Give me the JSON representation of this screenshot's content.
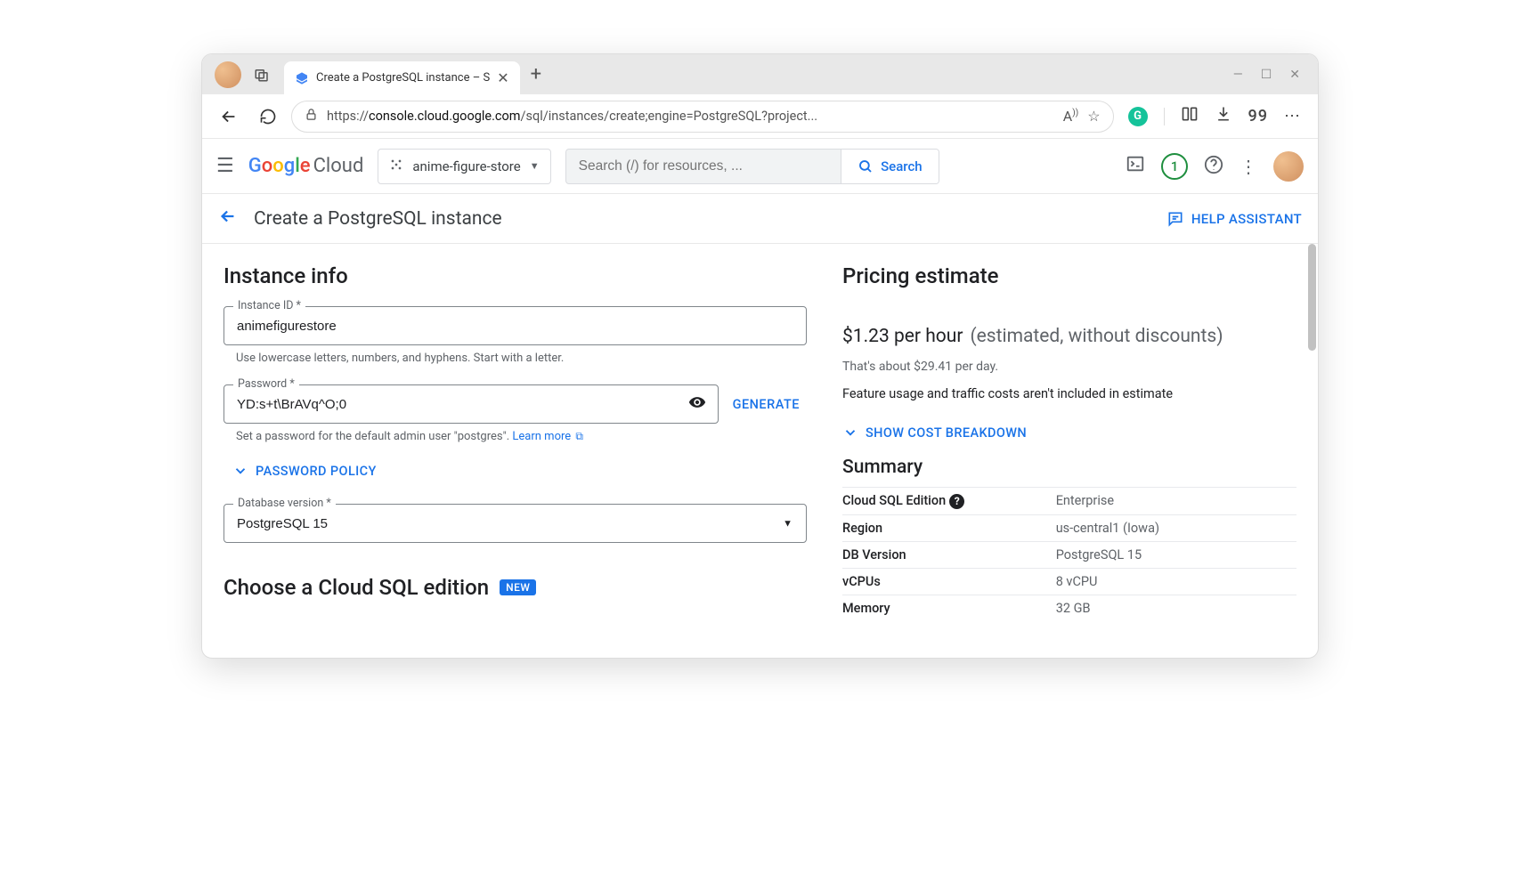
{
  "browser": {
    "tab_title": "Create a PostgreSQL instance – S",
    "url_display_prefix": "https://",
    "url_display_host": "console.cloud.google.com",
    "url_display_path": "/sql/instances/create;engine=PostgreSQL?project...",
    "quotes_action": "99"
  },
  "gcp_header": {
    "logo_suffix": "Cloud",
    "project_name": "anime-figure-store",
    "search_placeholder": "Search (/) for resources, ...",
    "search_button": "Search",
    "trial_count": "1"
  },
  "page": {
    "title": "Create a PostgreSQL instance",
    "help_assistant": "HELP ASSISTANT"
  },
  "form": {
    "section_title": "Instance info",
    "instance_id": {
      "label": "Instance ID *",
      "value": "animefigurestore",
      "help": "Use lowercase letters, numbers, and hyphens. Start with a letter."
    },
    "password": {
      "label": "Password *",
      "value": "YD:s+t\\BrAVq^O;0",
      "generate": "GENERATE",
      "help_prefix": "Set a password for the default admin user \"postgres\". ",
      "help_link": "Learn more"
    },
    "password_policy": "PASSWORD POLICY",
    "db_version": {
      "label": "Database version *",
      "value": "PostgreSQL 15"
    },
    "edition_heading": "Choose a Cloud SQL edition",
    "new_badge": "NEW"
  },
  "pricing": {
    "heading": "Pricing estimate",
    "main": "$1.23 per hour",
    "sub": "(estimated, without discounts)",
    "per_day": "That's about $29.41 per day.",
    "note": "Feature usage and traffic costs aren't included in estimate",
    "breakdown": "SHOW COST BREAKDOWN",
    "summary_heading": "Summary",
    "rows": [
      {
        "k": "Cloud SQL Edition",
        "v": "Enterprise",
        "help": true
      },
      {
        "k": "Region",
        "v": "us-central1 (Iowa)"
      },
      {
        "k": "DB Version",
        "v": "PostgreSQL 15"
      },
      {
        "k": "vCPUs",
        "v": "8 vCPU"
      },
      {
        "k": "Memory",
        "v": "32 GB"
      }
    ]
  }
}
